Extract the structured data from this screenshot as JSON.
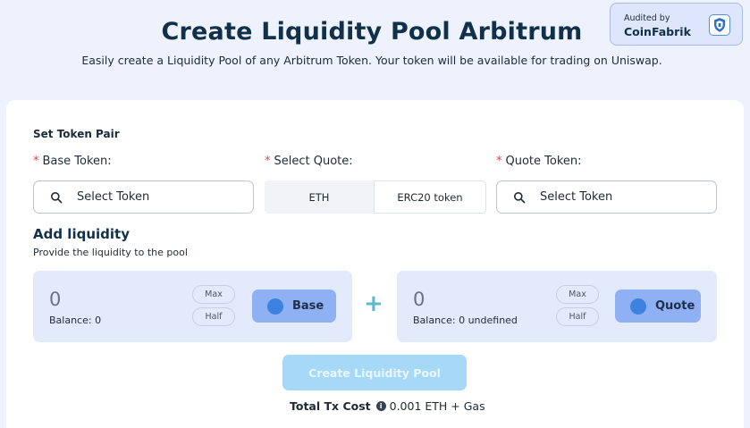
{
  "header": {
    "title": "Create Liquidity Pool Arbitrum",
    "subtitle": "Easily create a Liquidity Pool of any Arbitrum Token. Your token will be available for trading on Uniswap."
  },
  "audit": {
    "label": "Audited by",
    "name": "CoinFabrik",
    "icon": "shield-icon"
  },
  "token_pair": {
    "section_title": "Set Token Pair",
    "required_marker": "*",
    "base_label": "Base Token:",
    "base_placeholder": "Select Token",
    "quote_select_label": "Select Quote:",
    "quote_options": [
      "ETH",
      "ERC20 token"
    ],
    "quote_selected": "ERC20 token",
    "quote_token_label": "Quote Token:",
    "quote_placeholder": "Select Token"
  },
  "liquidity": {
    "title": "Add liquidity",
    "subtitle": "Provide the liquidity to the pool",
    "base_panel": {
      "amount": "0",
      "balance": "Balance: 0",
      "max_label": "Max",
      "half_label": "Half",
      "token_label": "Base"
    },
    "plus_symbol": "+",
    "quote_panel": {
      "amount": "0",
      "balance": "Balance: 0 undefined",
      "max_label": "Max",
      "half_label": "Half",
      "token_label": "Quote"
    }
  },
  "footer": {
    "create_button": "Create Liquidity Pool",
    "tx_cost_label": "Total Tx Cost",
    "info_icon": "i",
    "tx_cost_value": "0.001 ETH + Gas"
  },
  "colors": {
    "page_bg": "#eef2fc",
    "title": "#113049",
    "required": "#e0474c",
    "token_button": "#8fb1f4",
    "token_dot": "#3d82e0",
    "create_button_disabled": "#a6d9f8",
    "plus": "#5cb8cb"
  }
}
